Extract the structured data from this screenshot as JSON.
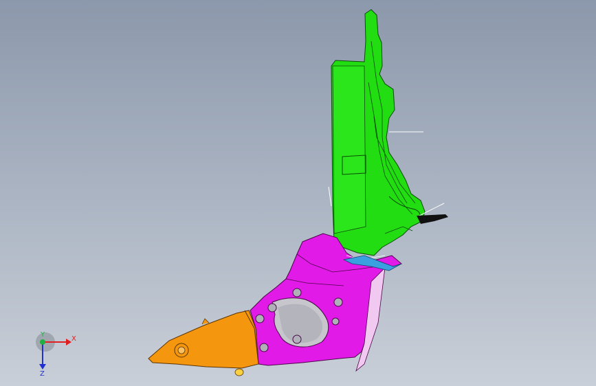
{
  "viewport": {
    "background_top": "#8c98ab",
    "background_bottom": "#c9cfd8"
  },
  "model": {
    "parts": [
      {
        "name": "upper-bracket",
        "color": "#22dd11"
      },
      {
        "name": "middle-bracket",
        "color": "#e21ae8"
      },
      {
        "name": "front-bracket",
        "color": "#f4960e"
      },
      {
        "name": "small-clip",
        "color": "#3aa0e0"
      }
    ]
  },
  "triad": {
    "x_label": "X",
    "y_label": "Y",
    "z_label": "Z",
    "x_color": "#e02020",
    "y_color": "#20b040",
    "z_color": "#2030d0"
  }
}
